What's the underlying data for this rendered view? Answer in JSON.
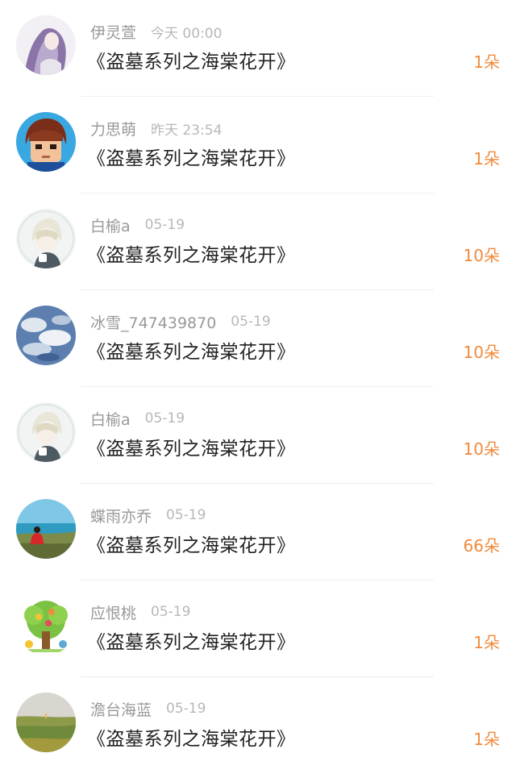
{
  "colors": {
    "amount": "#f08a3c",
    "username": "#999999",
    "time": "#b8b8b8",
    "title": "#222222",
    "divider": "#efefef"
  },
  "records": [
    {
      "user": "伊灵萱",
      "time": "今天 00:00",
      "title": "《盗墓系列之海棠花开》",
      "amount": "1朵",
      "avatar": "avatar-purple-hair-girl"
    },
    {
      "user": "力思萌",
      "time": "昨天 23:54",
      "title": "《盗墓系列之海棠花开》",
      "amount": "1朵",
      "avatar": "avatar-pixel-boy"
    },
    {
      "user": "白榆a",
      "time": "05-19",
      "title": "《盗墓系列之海棠花开》",
      "amount": "10朵",
      "avatar": "avatar-anime-white-hair"
    },
    {
      "user": "冰雪_747439870",
      "time": "05-19",
      "title": "《盗墓系列之海棠花开》",
      "amount": "10朵",
      "avatar": "avatar-cloudy-sky"
    },
    {
      "user": "白榆a",
      "time": "05-19",
      "title": "《盗墓系列之海棠花开》",
      "amount": "10朵",
      "avatar": "avatar-anime-white-hair"
    },
    {
      "user": "蝶雨亦乔",
      "time": "05-19",
      "title": "《盗墓系列之海棠花开》",
      "amount": "66朵",
      "avatar": "avatar-seaside-person"
    },
    {
      "user": "应恨桃",
      "time": "05-19",
      "title": "《盗墓系列之海棠花开》",
      "amount": "1朵",
      "avatar": "avatar-cartoon-tree"
    },
    {
      "user": "澹台海蓝",
      "time": "05-19",
      "title": "《盗墓系列之海棠花开》",
      "amount": "1朵",
      "avatar": "avatar-grassland"
    }
  ]
}
